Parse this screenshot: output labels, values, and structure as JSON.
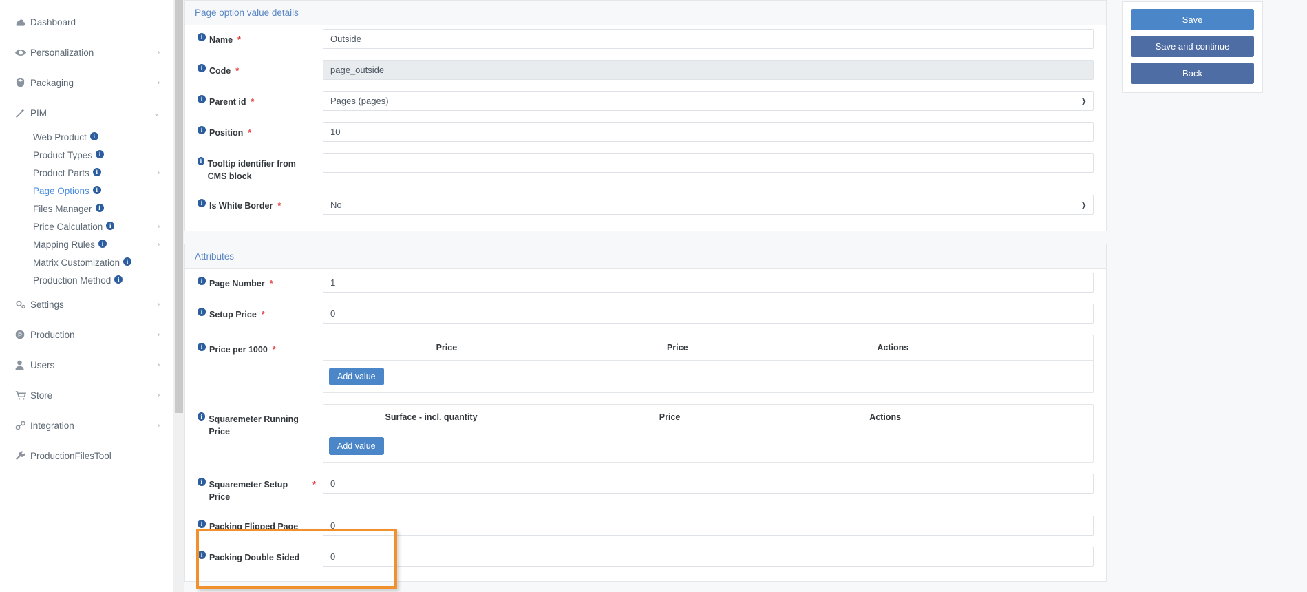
{
  "sidebar": {
    "items": [
      {
        "label": "Dashboard",
        "icon": "cloud-icon",
        "expandable": false,
        "chevron": ""
      },
      {
        "label": "Personalization",
        "icon": "eye-icon",
        "expandable": true,
        "chevron": "›"
      },
      {
        "label": "Packaging",
        "icon": "package-icon",
        "expandable": true,
        "chevron": "›"
      },
      {
        "label": "PIM",
        "icon": "wand-icon",
        "expandable": true,
        "chevron": "⌄",
        "expanded": true
      }
    ],
    "pim_children": [
      {
        "label": "Web Product",
        "info": true,
        "chevron": "",
        "active": false
      },
      {
        "label": "Product Types",
        "info": true,
        "chevron": "",
        "active": false
      },
      {
        "label": "Product Parts",
        "info": true,
        "chevron": "›",
        "active": false
      },
      {
        "label": "Page Options",
        "info": true,
        "chevron": "",
        "active": true
      },
      {
        "label": "Files Manager",
        "info": true,
        "chevron": "",
        "active": false
      },
      {
        "label": "Price Calculation",
        "info": true,
        "chevron": "›",
        "active": false
      },
      {
        "label": "Mapping Rules",
        "info": true,
        "chevron": "›",
        "active": false
      },
      {
        "label": "Matrix Customization",
        "info": true,
        "chevron": "",
        "active": false
      },
      {
        "label": "Production Method",
        "info": true,
        "chevron": "",
        "active": false
      }
    ],
    "items_bottom": [
      {
        "label": "Settings",
        "icon": "gears-icon",
        "expandable": true,
        "chevron": "›"
      },
      {
        "label": "Production",
        "icon": "circle-p-icon",
        "expandable": true,
        "chevron": "›"
      },
      {
        "label": "Users",
        "icon": "user-icon",
        "expandable": true,
        "chevron": "›"
      },
      {
        "label": "Store",
        "icon": "cart-icon",
        "expandable": true,
        "chevron": "›"
      },
      {
        "label": "Integration",
        "icon": "link-icon",
        "expandable": true,
        "chevron": "›"
      },
      {
        "label": "ProductionFilesTool",
        "icon": "wrench-icon",
        "expandable": false,
        "chevron": ""
      }
    ],
    "info_glyph": "i"
  },
  "details_card": {
    "title": "Page option value details",
    "fields": [
      {
        "label": "Name",
        "required": true,
        "type": "text",
        "value": "Outside",
        "disabled": false
      },
      {
        "label": "Code",
        "required": true,
        "type": "text",
        "value": "page_outside",
        "disabled": true
      },
      {
        "label": "Parent id",
        "required": true,
        "type": "select",
        "value": "Pages (pages)",
        "disabled": false
      },
      {
        "label": "Position",
        "required": true,
        "type": "text",
        "value": "10",
        "disabled": false
      },
      {
        "label": "Tooltip identifier from CMS block",
        "required": false,
        "type": "text",
        "value": "",
        "disabled": false
      },
      {
        "label": "Is White Border",
        "required": true,
        "type": "select",
        "value": "No",
        "disabled": false
      }
    ]
  },
  "attributes_card": {
    "title": "Attributes",
    "fields": [
      {
        "label": "Page Number",
        "required": true,
        "type": "text",
        "value": "1"
      },
      {
        "label": "Setup Price",
        "required": true,
        "type": "text",
        "value": "0"
      },
      {
        "label": "Price per 1000",
        "required": true,
        "type": "table",
        "columns": [
          "Price",
          "Price",
          "Actions"
        ],
        "rows": [],
        "add_button": "Add value"
      },
      {
        "label": "Squaremeter Running Price",
        "required": false,
        "type": "table",
        "columns": [
          "Surface - incl. quantity",
          "Price",
          "Actions"
        ],
        "rows": [],
        "add_button": "Add value"
      },
      {
        "label": "Squaremeter Setup Price",
        "required": true,
        "type": "text",
        "value": "0"
      },
      {
        "label": "Packing Flipped Page",
        "required": false,
        "type": "text",
        "value": "0",
        "highlighted": true
      },
      {
        "label": "Packing Double Sided",
        "required": false,
        "type": "text",
        "value": "0",
        "highlighted": true
      }
    ]
  },
  "actions": {
    "save_label": "Save",
    "save_continue_label": "Save and continue",
    "back_label": "Back"
  },
  "colors": {
    "accent_blue": "#4a86c8",
    "muted_blue": "#4f6da5",
    "header_link": "#5b87c4",
    "required_red": "#e03a3a",
    "highlight_orange": "#f0912d",
    "disabled_bg": "#e9ecef",
    "page_bg": "#f7f8fa"
  }
}
